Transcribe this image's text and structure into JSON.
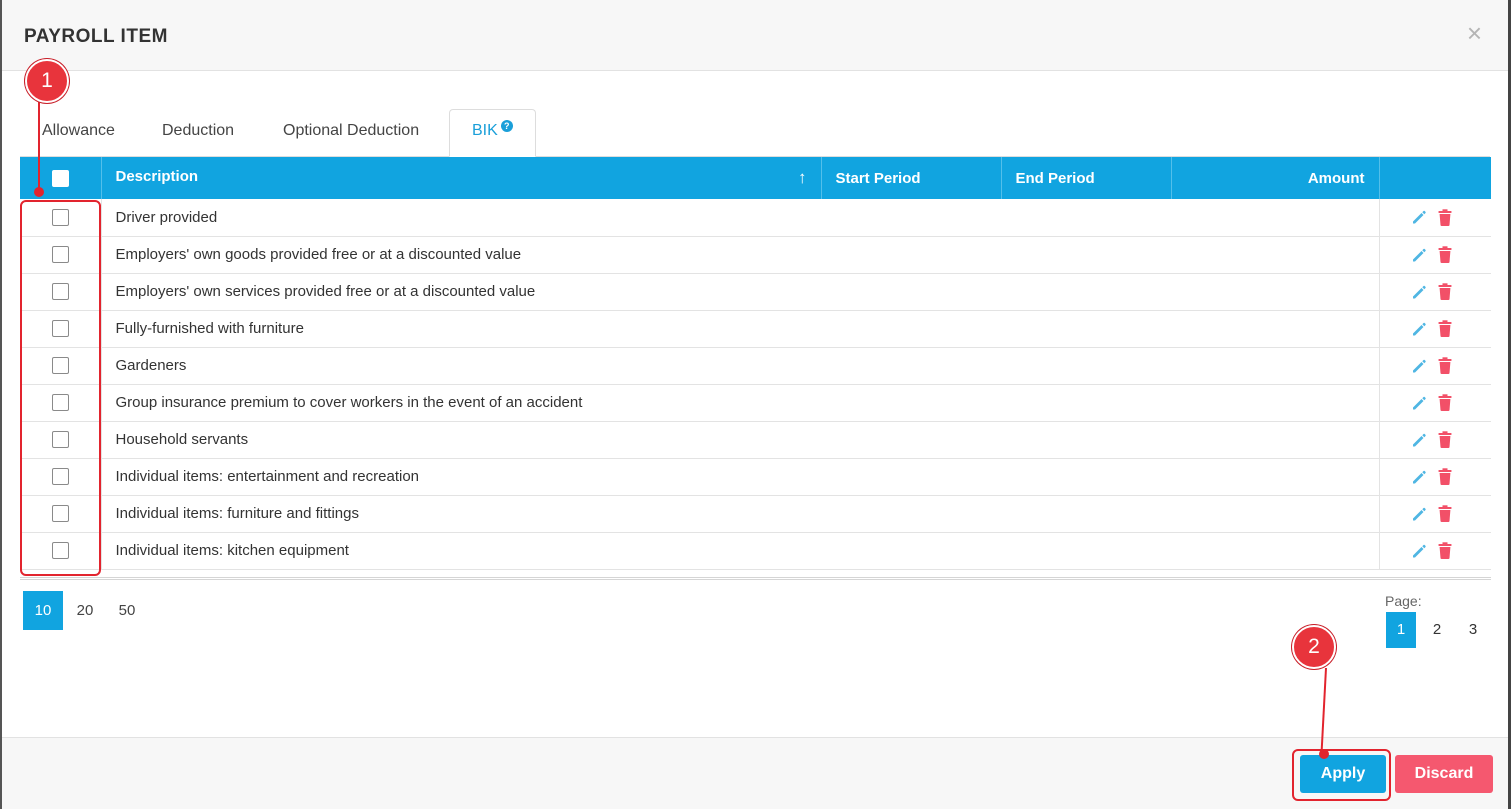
{
  "modal": {
    "title": "PAYROLL ITEM",
    "close_label": "×"
  },
  "tabs": [
    {
      "label": "Allowance"
    },
    {
      "label": "Deduction"
    },
    {
      "label": "Optional Deduction"
    },
    {
      "label": "BIK",
      "active": true
    }
  ],
  "table": {
    "columns": {
      "description": "Description",
      "start_period": "Start Period",
      "end_period": "End Period",
      "amount": "Amount"
    },
    "sort_indicator": "↑",
    "rows": [
      {
        "description": "Driver provided",
        "start_period": "",
        "end_period": "",
        "amount": ""
      },
      {
        "description": "Employers' own goods provided free or at a discounted value",
        "start_period": "",
        "end_period": "",
        "amount": ""
      },
      {
        "description": "Employers' own services provided free or at a discounted value",
        "start_period": "",
        "end_period": "",
        "amount": ""
      },
      {
        "description": "Fully-furnished with furniture",
        "start_period": "",
        "end_period": "",
        "amount": ""
      },
      {
        "description": "Gardeners",
        "start_period": "",
        "end_period": "",
        "amount": ""
      },
      {
        "description": "Group insurance premium to cover workers in the event of an accident",
        "start_period": "",
        "end_period": "",
        "amount": ""
      },
      {
        "description": "Household servants",
        "start_period": "",
        "end_period": "",
        "amount": ""
      },
      {
        "description": "Individual items: entertainment and recreation",
        "start_period": "",
        "end_period": "",
        "amount": ""
      },
      {
        "description": "Individual items: furniture and fittings",
        "start_period": "",
        "end_period": "",
        "amount": ""
      },
      {
        "description": "Individual items: kitchen equipment",
        "start_period": "",
        "end_period": "",
        "amount": ""
      }
    ]
  },
  "page_sizes": {
    "options": [
      "10",
      "20",
      "50"
    ],
    "selected": "10"
  },
  "pagination": {
    "label": "Page:",
    "pages": [
      "1",
      "2",
      "3"
    ],
    "current": "1"
  },
  "footer": {
    "apply_label": "Apply",
    "discard_label": "Discard"
  },
  "annotations": {
    "callout_1": "1",
    "callout_2": "2"
  },
  "colors": {
    "primary": "#11a4e0",
    "danger": "#f5586f",
    "callout": "#e2242e"
  },
  "icons": {
    "edit": "pencil-icon",
    "delete": "trash-icon",
    "help": "question-circle-icon",
    "sort": "sort-ascending-icon",
    "close": "close-icon"
  }
}
